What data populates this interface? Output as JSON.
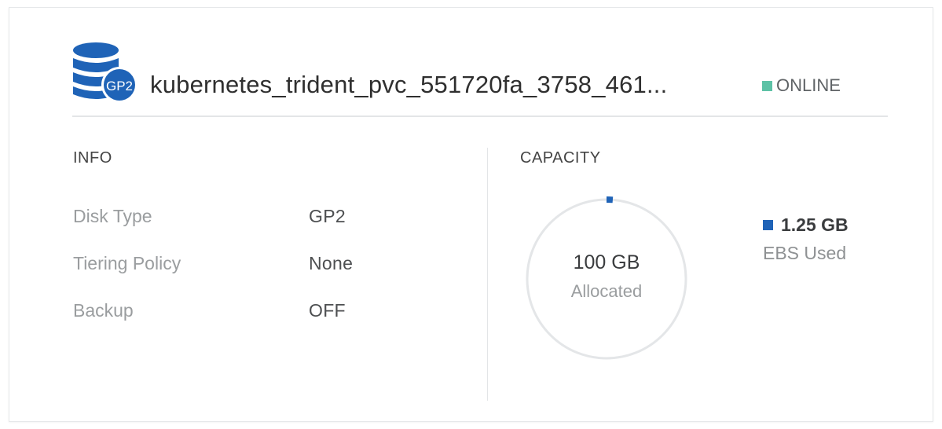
{
  "volume": {
    "icon_label": "GP2",
    "name": "kubernetes_trident_pvc_551720fa_3758_461...",
    "status": "ONLINE",
    "status_color": "#5dc2a6"
  },
  "info": {
    "title": "INFO",
    "rows": [
      {
        "label": "Disk Type",
        "value": "GP2"
      },
      {
        "label": "Tiering Policy",
        "value": "None"
      },
      {
        "label": "Backup",
        "value": "OFF"
      }
    ]
  },
  "capacity": {
    "title": "CAPACITY",
    "allocated_value": "100 GB",
    "allocated_label": "Allocated",
    "used_value": "1.25 GB",
    "used_label": "EBS Used",
    "used_fraction": 0.0125,
    "used_color": "#1f63b7"
  }
}
